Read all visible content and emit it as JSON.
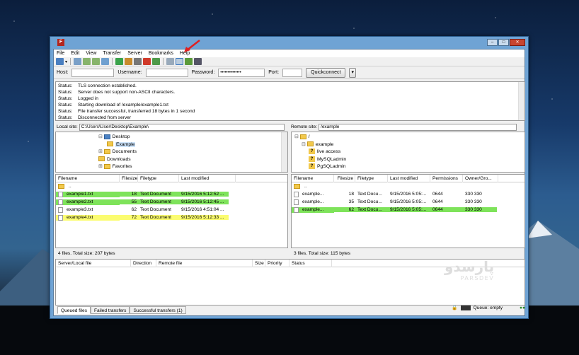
{
  "menu": [
    "File",
    "Edit",
    "View",
    "Transfer",
    "Server",
    "Bookmarks",
    "Help"
  ],
  "quickconnect": {
    "host_label": "Host:",
    "user_label": "Username:",
    "pass_label": "Password:",
    "pass_value": "••••••••••••••",
    "port_label": "Port:",
    "button": "Quickconnect"
  },
  "log": [
    {
      "t": "Status:",
      "m": "TLS connection established."
    },
    {
      "t": "Status:",
      "m": "Server does not support non-ASCII characters."
    },
    {
      "t": "Status:",
      "m": "Logged in"
    },
    {
      "t": "Status:",
      "m": "Starting download of /example/example1.txt"
    },
    {
      "t": "Status:",
      "m": "File transfer successful, transferred 18 bytes in 1 second"
    },
    {
      "t": "Status:",
      "m": "Disconnected from server"
    }
  ],
  "local": {
    "site_label": "Local site:",
    "path": "C:\\Users\\User\\Desktop\\Example\\",
    "tree": [
      "Desktop",
      "Example",
      "Documents",
      "Downloads",
      "Favorites"
    ],
    "headers": [
      "Filename",
      "Filesize",
      "Filetype",
      "Last modified"
    ],
    "files": [
      {
        "name": "..",
        "size": "",
        "type": "",
        "mod": ""
      },
      {
        "name": "example1.txt",
        "size": "18",
        "type": "Text Document",
        "mod": "9/15/2016 5:12:52 ..."
      },
      {
        "name": "example2.txt",
        "size": "55",
        "type": "Text Document",
        "mod": "9/15/2016 5:12:45 ..."
      },
      {
        "name": "example3.txt",
        "size": "62",
        "type": "Text Document",
        "mod": "9/15/2016 4:51:04 ..."
      },
      {
        "name": "example4.txt",
        "size": "72",
        "type": "Text Document",
        "mod": "9/15/2016 5:12:33 ..."
      }
    ],
    "status": "4 files. Total size: 207 bytes"
  },
  "remote": {
    "site_label": "Remote site:",
    "path": "/example",
    "tree": [
      "/",
      "example",
      "live access",
      "MySQLadmin",
      "PgSQLadmin"
    ],
    "headers": [
      "Filename",
      "Filesize",
      "Filetype",
      "Last modified",
      "Permissions",
      "Owner/Gro..."
    ],
    "files": [
      {
        "name": "..",
        "size": "",
        "type": "",
        "mod": "",
        "perm": "",
        "own": ""
      },
      {
        "name": "example...",
        "size": "18",
        "type": "Text Docu...",
        "mod": "9/15/2016 5:05:...",
        "perm": "0644",
        "own": "330 330"
      },
      {
        "name": "example...",
        "size": "35",
        "type": "Text Docu...",
        "mod": "9/15/2016 5:05:...",
        "perm": "0644",
        "own": "330 330"
      },
      {
        "name": "example...",
        "size": "62",
        "type": "Text Docu...",
        "mod": "9/15/2016 5:05:...",
        "perm": "0644",
        "own": "330 330"
      }
    ],
    "status": "3 files. Total size: 115 bytes"
  },
  "queue": {
    "headers": [
      "Server/Local file",
      "Direction",
      "Remote file",
      "Size",
      "Priority",
      "Status"
    ],
    "tabs": [
      "Queued files",
      "Failed transfers",
      "Successful transfers (1)"
    ],
    "footer": "Queue: empty"
  },
  "watermark": {
    "fa": "پارسدو",
    "en": "PARSDEV"
  },
  "colors": {
    "green": "#7ee35a",
    "yellow": "#fbfc70",
    "arrow": "#e02020"
  }
}
